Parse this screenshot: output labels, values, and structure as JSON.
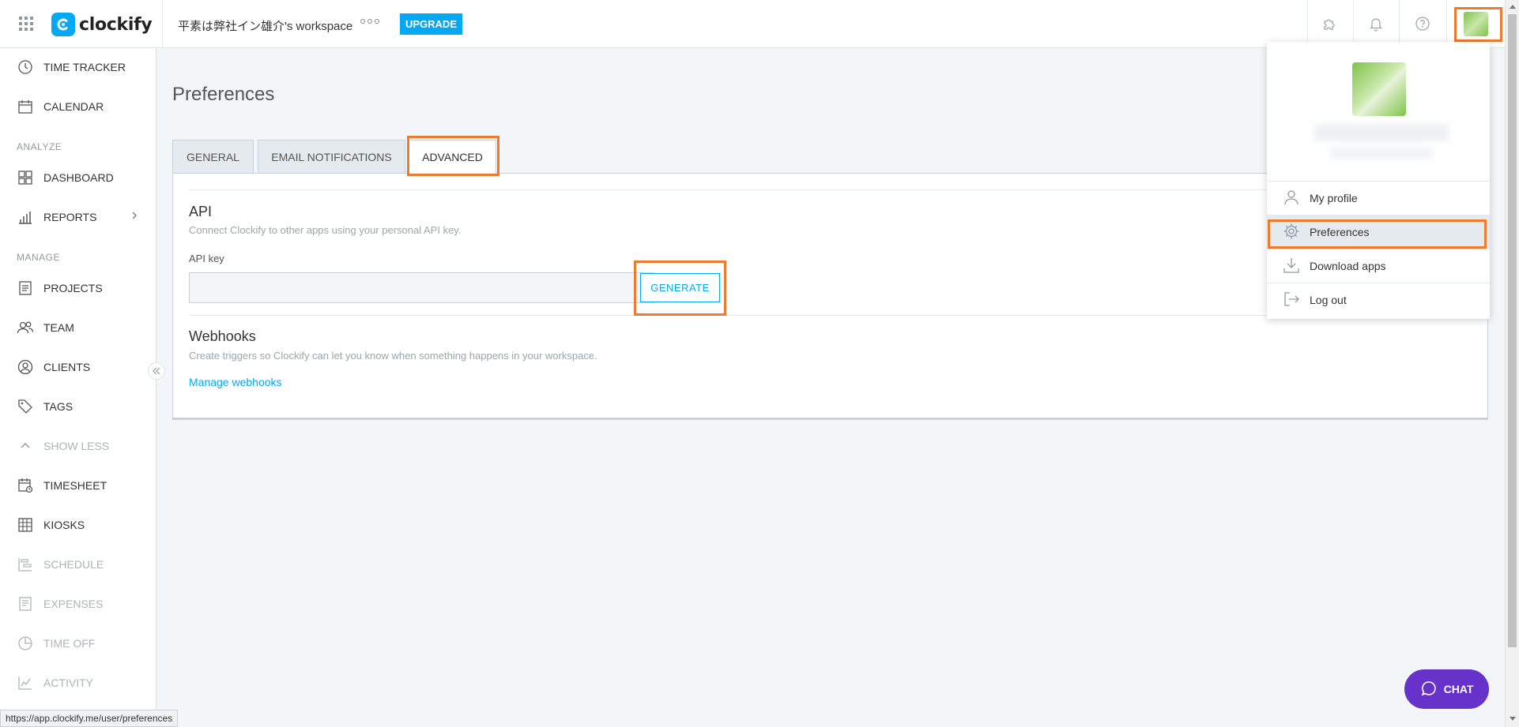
{
  "header": {
    "app_name": "clockify",
    "workspace": "平素は弊社イン雄介's workspace",
    "upgrade_label": "UPGRADE"
  },
  "sidebar": {
    "section_analyze": "ANALYZE",
    "section_manage": "MANAGE",
    "items": [
      {
        "label": "TIME TRACKER",
        "icon": "clock-icon"
      },
      {
        "label": "CALENDAR",
        "icon": "calendar-icon"
      },
      {
        "label": "DASHBOARD",
        "icon": "dashboard-icon"
      },
      {
        "label": "REPORTS",
        "icon": "bar-chart-icon"
      },
      {
        "label": "PROJECTS",
        "icon": "projects-icon"
      },
      {
        "label": "TEAM",
        "icon": "team-icon"
      },
      {
        "label": "CLIENTS",
        "icon": "clients-icon"
      },
      {
        "label": "TAGS",
        "icon": "tag-icon"
      },
      {
        "label": "SHOW LESS",
        "icon": "chevron-up-icon"
      },
      {
        "label": "TIMESHEET",
        "icon": "timesheet-icon"
      },
      {
        "label": "KIOSKS",
        "icon": "kiosk-icon"
      },
      {
        "label": "SCHEDULE",
        "icon": "schedule-icon"
      },
      {
        "label": "EXPENSES",
        "icon": "expenses-icon"
      },
      {
        "label": "TIME OFF",
        "icon": "time-off-icon"
      },
      {
        "label": "ACTIVITY",
        "icon": "activity-icon"
      }
    ]
  },
  "main": {
    "title": "Preferences",
    "tabs": [
      {
        "label": "GENERAL"
      },
      {
        "label": "EMAIL NOTIFICATIONS"
      },
      {
        "label": "ADVANCED"
      }
    ],
    "api": {
      "title": "API",
      "description": "Connect Clockify to other apps using your personal API key.",
      "key_label": "API key",
      "key_value": "",
      "generate_label": "GENERATE"
    },
    "webhooks": {
      "title": "Webhooks",
      "description": "Create triggers so Clockify can let you know when something happens in your workspace.",
      "manage_link": "Manage webhooks"
    }
  },
  "user_menu": {
    "items": [
      {
        "label": "My profile",
        "icon": "user-icon"
      },
      {
        "label": "Preferences",
        "icon": "gear-icon"
      },
      {
        "label": "Download apps",
        "icon": "download-icon"
      },
      {
        "label": "Log out",
        "icon": "logout-icon"
      }
    ]
  },
  "chat_label": "CHAT",
  "status_url": "https://app.clockify.me/user/preferences",
  "colors": {
    "accent": "#03a9f4",
    "highlight": "#ee7a2d",
    "chat": "#6732c9"
  }
}
